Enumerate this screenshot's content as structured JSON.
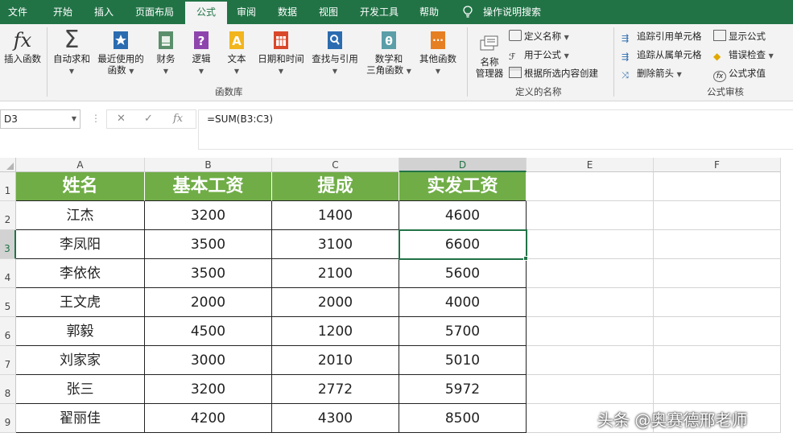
{
  "tabs": [
    "文件",
    "开始",
    "插入",
    "页面布局",
    "公式",
    "审阅",
    "数据",
    "视图",
    "开发工具",
    "帮助"
  ],
  "active_tab": "公式",
  "tell_me": "操作说明搜索",
  "ribbon": {
    "insert_function": "插入函数",
    "autosum": "自动求和",
    "recent_line1": "最近使用的",
    "recent_line2": "函数",
    "financial": "财务",
    "logical": "逻辑",
    "text": "文本",
    "datetime": "日期和时间",
    "lookup": "查找与引用",
    "math_line1": "数学和",
    "math_line2": "三角函数",
    "more": "其他函数",
    "library_group": "函数库",
    "name_manager_line1": "名称",
    "name_manager_line2": "管理器",
    "define_name": "定义名称",
    "use_in_formula": "用于公式",
    "create_from_selection": "根据所选内容创建",
    "names_group": "定义的名称",
    "trace_precedents": "追踪引用单元格",
    "trace_dependents": "追踪从属单元格",
    "remove_arrows": "删除箭头",
    "show_formulas": "显示公式",
    "error_checking": "错误检查",
    "evaluate_formula": "公式求值",
    "auditing_group": "公式审核",
    "fx_symbol": "fx",
    "sigma_symbol": "Σ"
  },
  "formula_bar": {
    "name_box": "D3",
    "formula": "=SUM(B3:C3)",
    "cancel": "✕",
    "enter": "✓",
    "fx": "fx",
    "dots": "⋮"
  },
  "grid": {
    "columns": [
      "A",
      "B",
      "C",
      "D",
      "E",
      "F"
    ],
    "rows": [
      "1",
      "2",
      "3",
      "4",
      "5",
      "6",
      "7",
      "8",
      "9"
    ],
    "headers": [
      "姓名",
      "基本工资",
      "提成",
      "实发工资"
    ],
    "data": [
      [
        "江杰",
        "3200",
        "1400",
        "4600"
      ],
      [
        "李凤阳",
        "3500",
        "3100",
        "6600"
      ],
      [
        "李依依",
        "3500",
        "2100",
        "5600"
      ],
      [
        "王文虎",
        "2000",
        "2000",
        "4000"
      ],
      [
        "郭毅",
        "4500",
        "1200",
        "5700"
      ],
      [
        "刘家家",
        "3000",
        "2010",
        "5010"
      ],
      [
        "张三",
        "3200",
        "2772",
        "5972"
      ],
      [
        "翟丽佳",
        "4200",
        "4300",
        "8500"
      ]
    ],
    "active_cell": "D3"
  },
  "watermark": "头条 @奥赛德邢老师",
  "colors": {
    "excel_green": "#217346",
    "header_fill": "#70ad47"
  }
}
